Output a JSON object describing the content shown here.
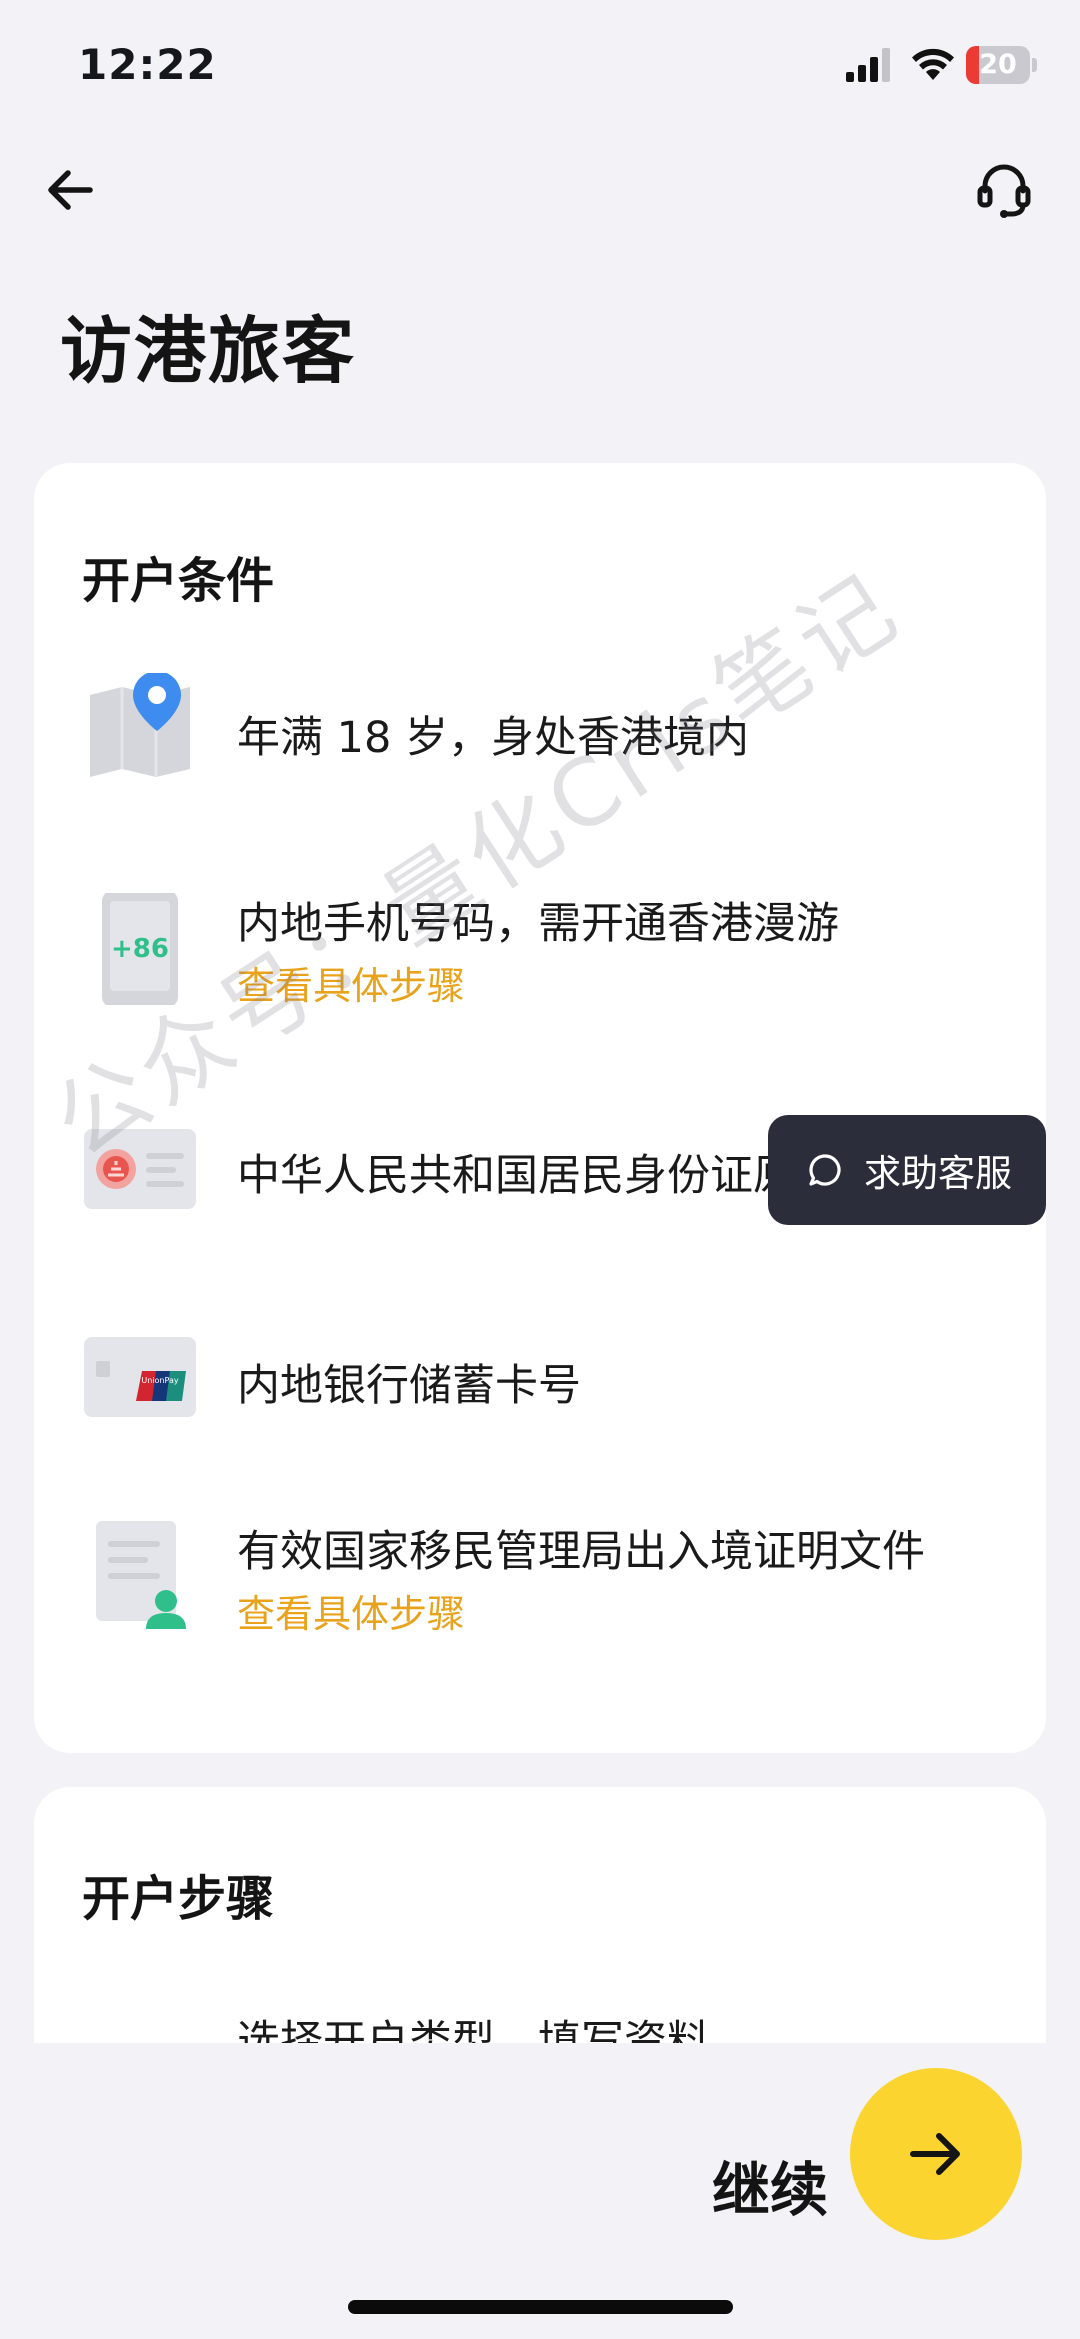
{
  "status_bar": {
    "time": "12:22",
    "battery_level": "20",
    "battery_fraction": 0.2,
    "signal_icon": "cellular-signal-icon",
    "wifi_icon": "wifi-icon"
  },
  "nav": {
    "back_icon": "arrow-left-icon",
    "support_icon": "headset-icon"
  },
  "page_title": "访港旅客",
  "conditions": {
    "title": "开户条件",
    "items": [
      {
        "icon": "map-pin-icon",
        "text": "年满 18 岁，身处香港境内"
      },
      {
        "icon": "phone-plus86-icon",
        "phone_code": "+86",
        "text": "内地手机号码，需开通香港漫游",
        "link": "查看具体步骤"
      },
      {
        "icon": "id-card-icon",
        "text": "中华人民共和国居民身份证原件"
      },
      {
        "icon": "unionpay-card-icon",
        "card_brand": "UnionPay",
        "text": "内地银行储蓄卡号"
      },
      {
        "icon": "document-person-icon",
        "text": "有效国家移民管理局出入境证明文件",
        "link": "查看具体步骤"
      }
    ]
  },
  "help": {
    "icon": "chat-bubble-icon",
    "label": "求助客服"
  },
  "steps": {
    "title": "开户步骤",
    "first_step": "选择开户类型，填写资料"
  },
  "footer": {
    "continue_label": "继续",
    "continue_icon": "arrow-right-icon"
  },
  "watermark": "公众号：量化Cris笔记",
  "colors": {
    "accent_yellow": "#fcd42f",
    "link_orange": "#e8a21c",
    "background": "#f2f2f7",
    "help_bubble": "#2c2d3a"
  }
}
